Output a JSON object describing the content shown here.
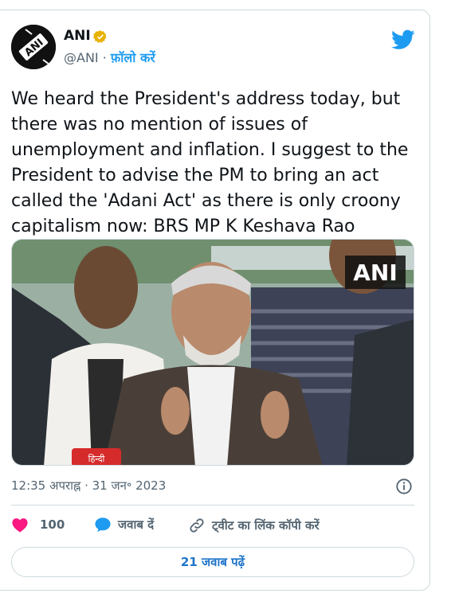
{
  "tweet": {
    "author_name": "ANI",
    "handle": "@ANI",
    "separator": " · ",
    "follow_label": "फ़ॉलो करें",
    "text": "We heard the President's address today, but there was no mention of issues of unemployment and inflation. I suggest to the President to advise the PM to bring an act called the 'Adani Act' as there is only croony capitalism now: BRS MP K Keshava Rao",
    "timestamp": "12:35 अपराह्न · 31 जन॰ 2023",
    "likes_count": "100",
    "reply_label": "जवाब दें",
    "copy_link_label": "ट्वीट का लिंक कॉपी करें",
    "read_replies_label": "21 जवाब पढ़ें",
    "media_watermark": "ANI",
    "mic_label": "हिन्दी"
  },
  "avatar_logo_text": "ANI",
  "colors": {
    "accent": "#1d9bf0",
    "like": "#f91880",
    "verified": "#e8b200",
    "muted": "#536471",
    "border": "#cfd9de"
  },
  "icons": [
    "twitter-bird-icon",
    "verified-badge-icon",
    "heart-icon",
    "reply-bubble-icon",
    "link-icon",
    "info-icon"
  ]
}
